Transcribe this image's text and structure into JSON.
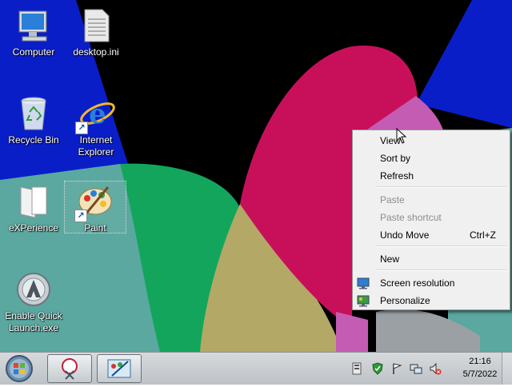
{
  "desktop": {
    "icons": [
      {
        "label": "Computer",
        "icon": "computer-icon"
      },
      {
        "label": "desktop.ini",
        "icon": "ini-file-icon"
      },
      {
        "label": "Recycle Bin",
        "icon": "recycle-bin-icon"
      },
      {
        "label": "Internet Explorer",
        "icon": "internet-explorer-icon"
      },
      {
        "label": "eXPerience",
        "icon": "folder-icon"
      },
      {
        "label": "Paint",
        "icon": "paint-icon"
      },
      {
        "label": "Enable Quick Launch.exe",
        "icon": "quick-launch-icon"
      }
    ]
  },
  "context_menu": {
    "items": [
      {
        "label": "View",
        "enabled": true
      },
      {
        "label": "Sort by",
        "enabled": true
      },
      {
        "label": "Refresh",
        "enabled": true
      },
      {
        "label": "Paste",
        "enabled": false
      },
      {
        "label": "Paste shortcut",
        "enabled": false
      },
      {
        "label": "Undo Move",
        "shortcut": "Ctrl+Z",
        "enabled": true
      },
      {
        "label": "New",
        "enabled": true
      },
      {
        "label": "Screen resolution",
        "icon": "monitor-icon",
        "enabled": true
      },
      {
        "label": "Personalize",
        "icon": "personalize-icon",
        "enabled": true
      }
    ]
  },
  "taskbar": {
    "buttons": [
      {
        "name": "Snipping Tool",
        "icon": "snipping-tool-icon"
      },
      {
        "name": "Paint",
        "icon": "paint-icon"
      }
    ],
    "tray_icons": [
      "server-icon",
      "security-shield-icon",
      "action-center-flag-icon",
      "network-icon",
      "volume-muted-icon"
    ],
    "clock": {
      "time": "21:16",
      "date": "5/7/2022"
    }
  },
  "colors": {
    "wallpaper_blue": "#0a1ec8",
    "wallpaper_black": "#000000",
    "wallpaper_teal": "#5aa8a0",
    "wallpaper_green": "#13a55c",
    "wallpaper_olive": "#b3a866",
    "wallpaper_crimson": "#c8105a",
    "wallpaper_pink": "#c45cb4",
    "wallpaper_grey": "#9aa0a4"
  }
}
